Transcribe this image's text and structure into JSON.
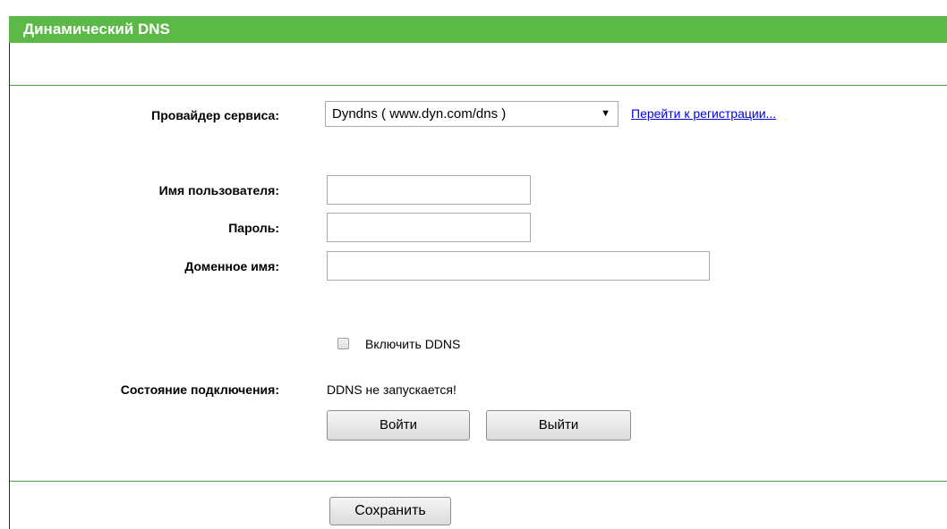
{
  "page": {
    "title": "Динамический DNS"
  },
  "form": {
    "provider_label": "Провайдер сервиса:",
    "provider_value": "Dyndns ( www.dyn.com/dns )",
    "provider_arrow": "▼",
    "register_link": "Перейти к регистрации...",
    "username_label": "Имя пользователя:",
    "username_value": "",
    "password_label": "Пароль:",
    "password_value": "",
    "domain_label": "Доменное имя:",
    "domain_value": "",
    "enable_ddns_label": "Включить DDNS",
    "enable_ddns_checked": false,
    "status_label": "Состояние подключения:",
    "status_value": "DDNS не запускается!",
    "login_button": "Войти",
    "logout_button": "Выйти"
  },
  "footer": {
    "save_button": "Сохранить"
  },
  "colors": {
    "header_green": "#5cb947",
    "divider_green": "#4aa33f",
    "link_blue": "#0000ee"
  }
}
